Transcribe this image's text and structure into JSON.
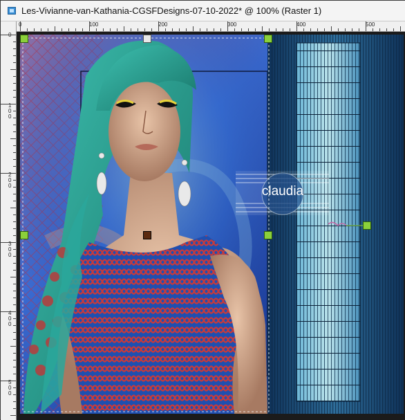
{
  "window": {
    "title": "Les-Vivianne-van-Kathania-CGSFDesigns-07-10-2022* @ 100% (Raster 1)"
  },
  "ruler": {
    "top_labels": [
      "100",
      "200",
      "300",
      "400",
      "500"
    ],
    "left_labels": [
      "1 0 0",
      "2 0 0",
      "3 0 0",
      "4 0 0",
      "5 0 0"
    ],
    "origin_label": "0"
  },
  "watermark": {
    "text": "claudia"
  },
  "colors": {
    "selection_handle": "#8bd03a",
    "marquee": "#ffffff",
    "stripe_dark": "#123a66",
    "stripe_light": "#5fa6c9",
    "dress_red": "#c93a3a",
    "dress_blue": "#1f4fb0",
    "hair_teal": "#2aa79b"
  }
}
